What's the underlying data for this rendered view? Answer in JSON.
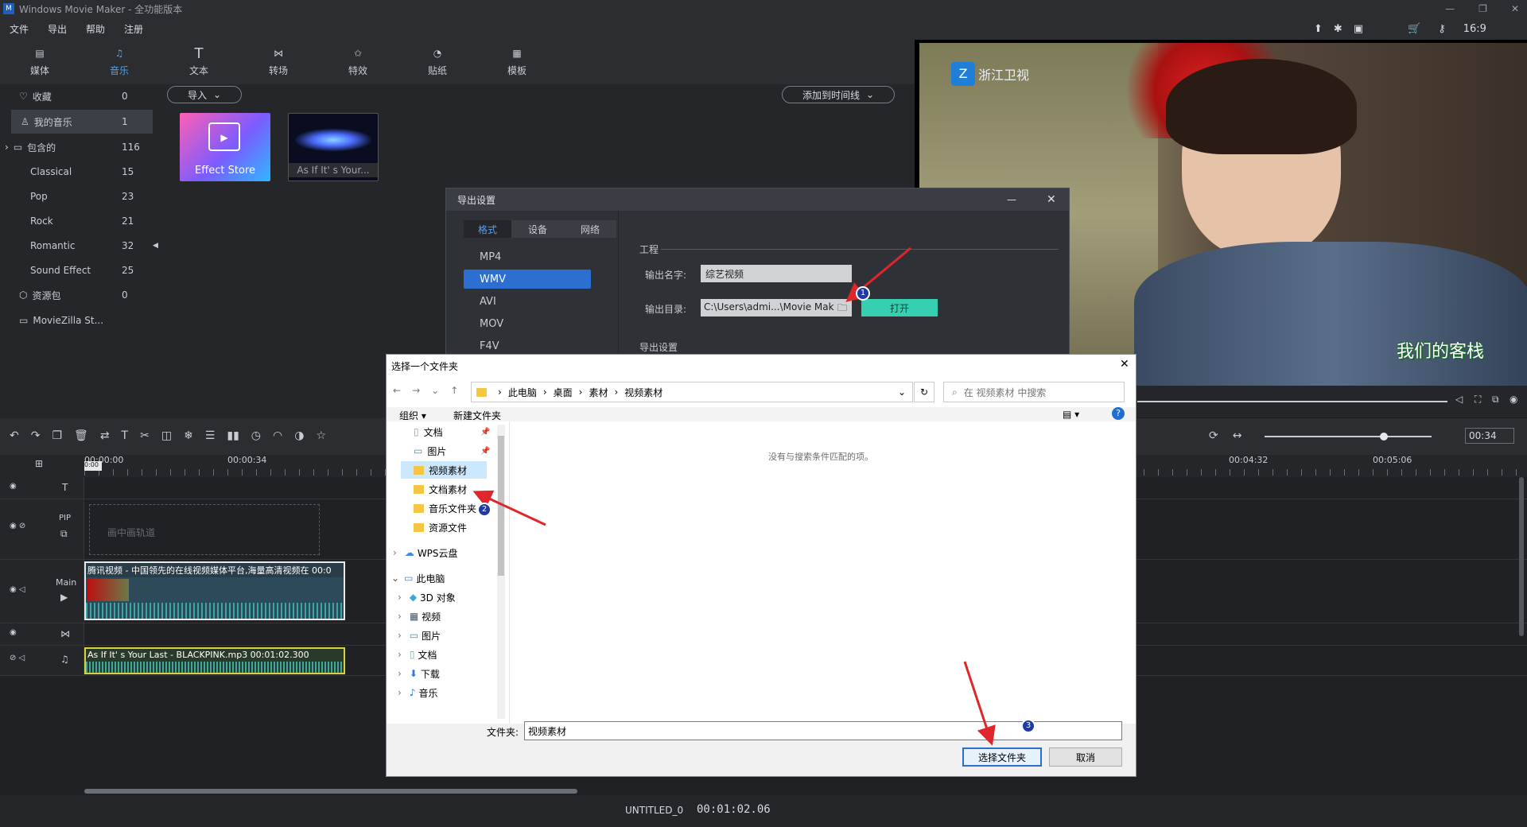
{
  "app": {
    "title": "Windows Movie Maker - 全功能版本",
    "project": "UNTITLED_0",
    "timecode": "00:01:02.06"
  },
  "menu": [
    "文件",
    "导出",
    "帮助",
    "注册"
  ],
  "tools": [
    {
      "label": "媒体",
      "icon": "media-icon"
    },
    {
      "label": "音乐",
      "icon": "music-icon"
    },
    {
      "label": "文本",
      "icon": "text-icon"
    },
    {
      "label": "转场",
      "icon": "transition-icon"
    },
    {
      "label": "特效",
      "icon": "effects-icon"
    },
    {
      "label": "贴纸",
      "icon": "sticker-icon"
    },
    {
      "label": "模板",
      "icon": "template-icon"
    }
  ],
  "active_tool": "音乐",
  "library": [
    {
      "label": "收藏",
      "count": "0"
    },
    {
      "label": "我的音乐",
      "count": "1"
    },
    {
      "label": "包含的",
      "count": "116"
    },
    {
      "label": "Classical",
      "count": "15"
    },
    {
      "label": "Pop",
      "count": "23"
    },
    {
      "label": "Rock",
      "count": "21"
    },
    {
      "label": "Romantic",
      "count": "32"
    },
    {
      "label": "Sound Effect",
      "count": "25"
    },
    {
      "label": "资源包",
      "count": "0"
    },
    {
      "label": "MovieZilla St...",
      "count": ""
    }
  ],
  "media": {
    "import_label": "导入",
    "add_label": "添加到时间线",
    "items": [
      {
        "label": "Effect Store"
      },
      {
        "label": "As If It' s Your..."
      }
    ]
  },
  "preview": {
    "time": "00:34",
    "watermark": "浙江卫视",
    "overlay": "我们的客栈"
  },
  "timeline": {
    "ruler": [
      "00:00:00",
      "00:00:34",
      "00:04:32",
      "00:05:06"
    ],
    "pip_label": "PIP",
    "pip_placeholder": "画中画轨道",
    "main_label": "Main",
    "video_clip": "腾讯视频 - 中国领先的在线视频媒体平台,海量高清视频在 00:0",
    "audio_clip": "As If It' s Your Last - BLACKPINK.mp3   00:01:02.300"
  },
  "export_dialog": {
    "title": "导出设置",
    "tabs": [
      "格式",
      "设备",
      "网络"
    ],
    "formats": [
      "MP4",
      "WMV",
      "AVI",
      "MOV",
      "F4V"
    ],
    "selected": "WMV",
    "section": "工程",
    "name_label": "输出名字:",
    "name_value": "综艺视频",
    "dir_label": "输出目录:",
    "dir_value": "C:\\Users\\admi...\\Movie Mak",
    "open_label": "打开",
    "sub_section": "导出设置"
  },
  "folder_dialog": {
    "title": "选择一个文件夹",
    "path": [
      "此电脑",
      "桌面",
      "素材",
      "视频素材"
    ],
    "search_placeholder": "在 视频素材 中搜索",
    "organize": "组织",
    "new_folder": "新建文件夹",
    "empty": "没有与搜索条件匹配的项。",
    "tree": [
      {
        "label": "文档",
        "pin": true
      },
      {
        "label": "图片",
        "pin": true
      },
      {
        "label": "视频素材",
        "sel": true
      },
      {
        "label": "文档素材"
      },
      {
        "label": "音乐文件夹"
      },
      {
        "label": "资源文件"
      },
      {
        "label": "WPS云盘"
      },
      {
        "label": "此电脑"
      },
      {
        "label": "3D 对象"
      },
      {
        "label": "视频"
      },
      {
        "label": "图片"
      },
      {
        "label": "文档"
      },
      {
        "label": "下载"
      },
      {
        "label": "音乐"
      }
    ],
    "folder_label": "文件夹:",
    "folder_value": "视频素材",
    "select_btn": "选择文件夹",
    "cancel_btn": "取消"
  },
  "annotations": [
    "1",
    "2",
    "3"
  ],
  "colors": {
    "accent": "#2d6fd0",
    "teal": "#36d0b0",
    "arrow": "#e0262a"
  }
}
